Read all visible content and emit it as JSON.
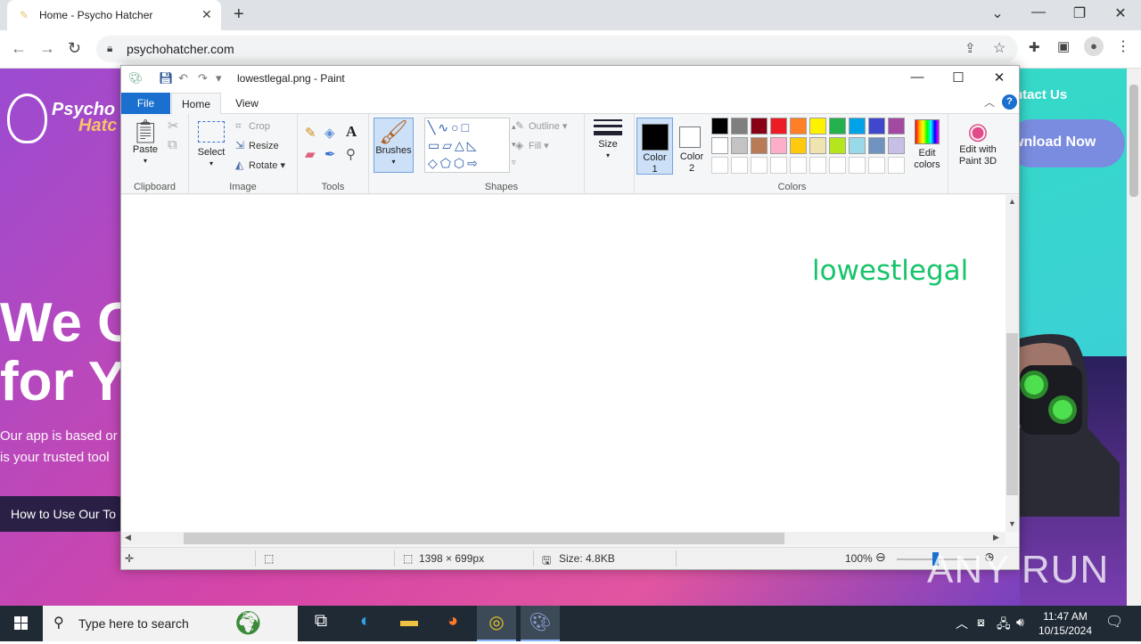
{
  "browser": {
    "tab_title": "Home - Psycho Hatcher",
    "url": "psychohatcher.com"
  },
  "website": {
    "logo_line1": "Psycho",
    "logo_line2": "Hatc",
    "hero_line1": "We C",
    "hero_line2": "for Y",
    "paragraph_line1": "Our app is based or",
    "paragraph_line2": "is your trusted tool",
    "how_button": "How to Use Our To",
    "contact": "ntact Us",
    "download": "wnload Now"
  },
  "paint": {
    "title": "lowestlegal.png - Paint",
    "tabs": {
      "file": "File",
      "home": "Home",
      "view": "View"
    },
    "groups": {
      "clipboard": "Clipboard",
      "image": "Image",
      "tools": "Tools",
      "shapes": "Shapes",
      "colors": "Colors"
    },
    "buttons": {
      "paste": "Paste",
      "select": "Select",
      "crop": "Crop",
      "resize": "Resize",
      "rotate": "Rotate",
      "brushes": "Brushes",
      "outline": "Outline",
      "fill": "Fill",
      "size": "Size",
      "color1_a": "Color",
      "color1_b": "1",
      "color2_a": "Color",
      "color2_b": "2",
      "edit_colors_a": "Edit",
      "edit_colors_b": "colors",
      "paint3d_a": "Edit with",
      "paint3d_b": "Paint 3D"
    },
    "palette_row1": [
      "#000000",
      "#7f7f7f",
      "#880015",
      "#ed1c24",
      "#ff7f27",
      "#fff200",
      "#22b14c",
      "#00a2e8",
      "#3f48cc",
      "#a349a4"
    ],
    "palette_row2": [
      "#ffffff",
      "#c3c3c3",
      "#b97a57",
      "#ffaec9",
      "#ffc90e",
      "#efe4b0",
      "#b5e61d",
      "#99d9ea",
      "#7092be",
      "#c8bfe7"
    ],
    "canvas_text": "lowestlegal",
    "status": {
      "dimensions": "1398 × 699px",
      "size": "Size: 4.8KB",
      "zoom": "100%"
    }
  },
  "taskbar": {
    "search_placeholder": "Type here to search",
    "time": "11:47 AM",
    "date": "10/15/2024"
  },
  "watermark": "ANY RUN"
}
